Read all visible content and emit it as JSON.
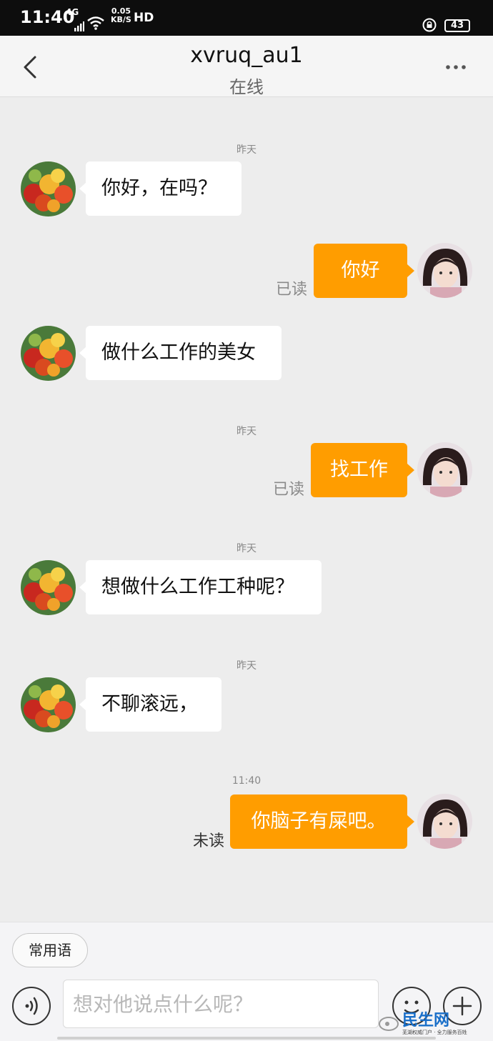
{
  "status_bar": {
    "time": "11:40",
    "network": "4G",
    "speed_value": "0.05",
    "speed_unit": "KB/S",
    "hd": "HD",
    "battery": "43"
  },
  "header": {
    "title": "xvruq_au1",
    "status": "在线"
  },
  "messages": [
    {
      "timestamp": "昨天",
      "direction": "incoming",
      "text": "你好，在吗？",
      "avatar": "fruit-avatar"
    },
    {
      "direction": "outgoing",
      "text": "你好",
      "read_status": "已读",
      "avatar": "girl-avatar"
    },
    {
      "direction": "incoming",
      "text": "做什么工作的美女",
      "avatar": "fruit-avatar"
    },
    {
      "timestamp": "昨天",
      "direction": "outgoing",
      "text": "找工作",
      "read_status": "已读",
      "avatar": "girl-avatar"
    },
    {
      "timestamp": "昨天",
      "direction": "incoming",
      "text": "想做什么工作工种呢？",
      "avatar": "fruit-avatar"
    },
    {
      "timestamp": "昨天",
      "direction": "incoming",
      "text": "不聊滚远，",
      "avatar": "fruit-avatar"
    },
    {
      "timestamp": "11:40",
      "direction": "outgoing",
      "text": "你脑子有屎吧。",
      "read_status": "未读",
      "avatar": "girl-avatar"
    }
  ],
  "input_bar": {
    "quick_phrase_label": "常用语",
    "placeholder": "想对他说点什么呢？"
  },
  "watermark": {
    "text": "民生网",
    "subtext": "芜湖权威门户 · 全力服务百姓"
  },
  "colors": {
    "outgoing_bubble": "#ff9d00",
    "incoming_bubble": "#ffffff",
    "background": "#ededed"
  }
}
